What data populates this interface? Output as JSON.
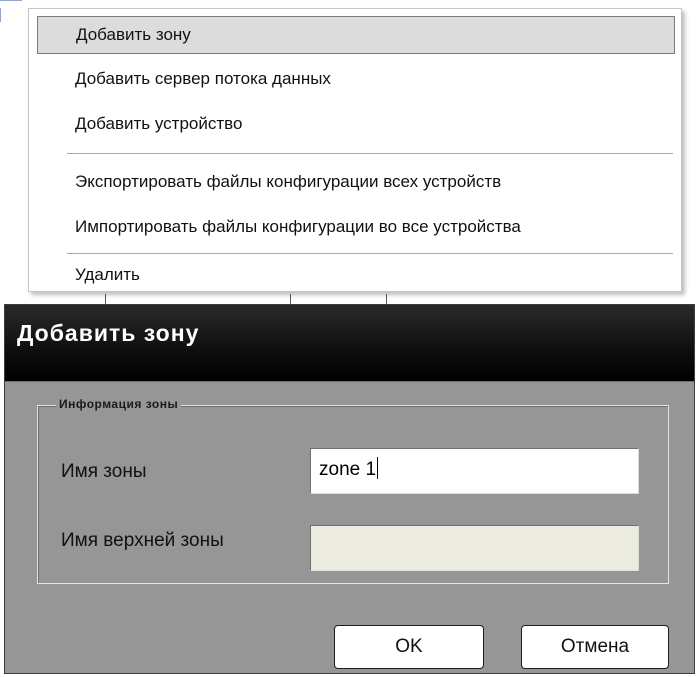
{
  "context_menu": {
    "groups": [
      {
        "items": [
          {
            "label": "Добавить зону",
            "active": true
          },
          {
            "label": "Добавить сервер потока данных",
            "active": false
          },
          {
            "label": "Добавить устройство",
            "active": false
          }
        ]
      },
      {
        "items": [
          {
            "label": "Экспортировать файлы конфигурации всех устройств",
            "active": false
          },
          {
            "label": "Импортировать файлы конфигурации во все устройства",
            "active": false
          }
        ]
      },
      {
        "items": [
          {
            "label": "Удалить",
            "active": false
          }
        ]
      }
    ]
  },
  "dialog": {
    "title": "Добавить зону",
    "group_label": "Информация зоны",
    "fields": {
      "zone_name": {
        "label": "Имя зоны",
        "value": "zone 1"
      },
      "parent_zone": {
        "label": "Имя верхней зоны",
        "value": "",
        "disabled": true
      }
    },
    "buttons": {
      "ok": "OK",
      "cancel": "Отмена"
    }
  }
}
